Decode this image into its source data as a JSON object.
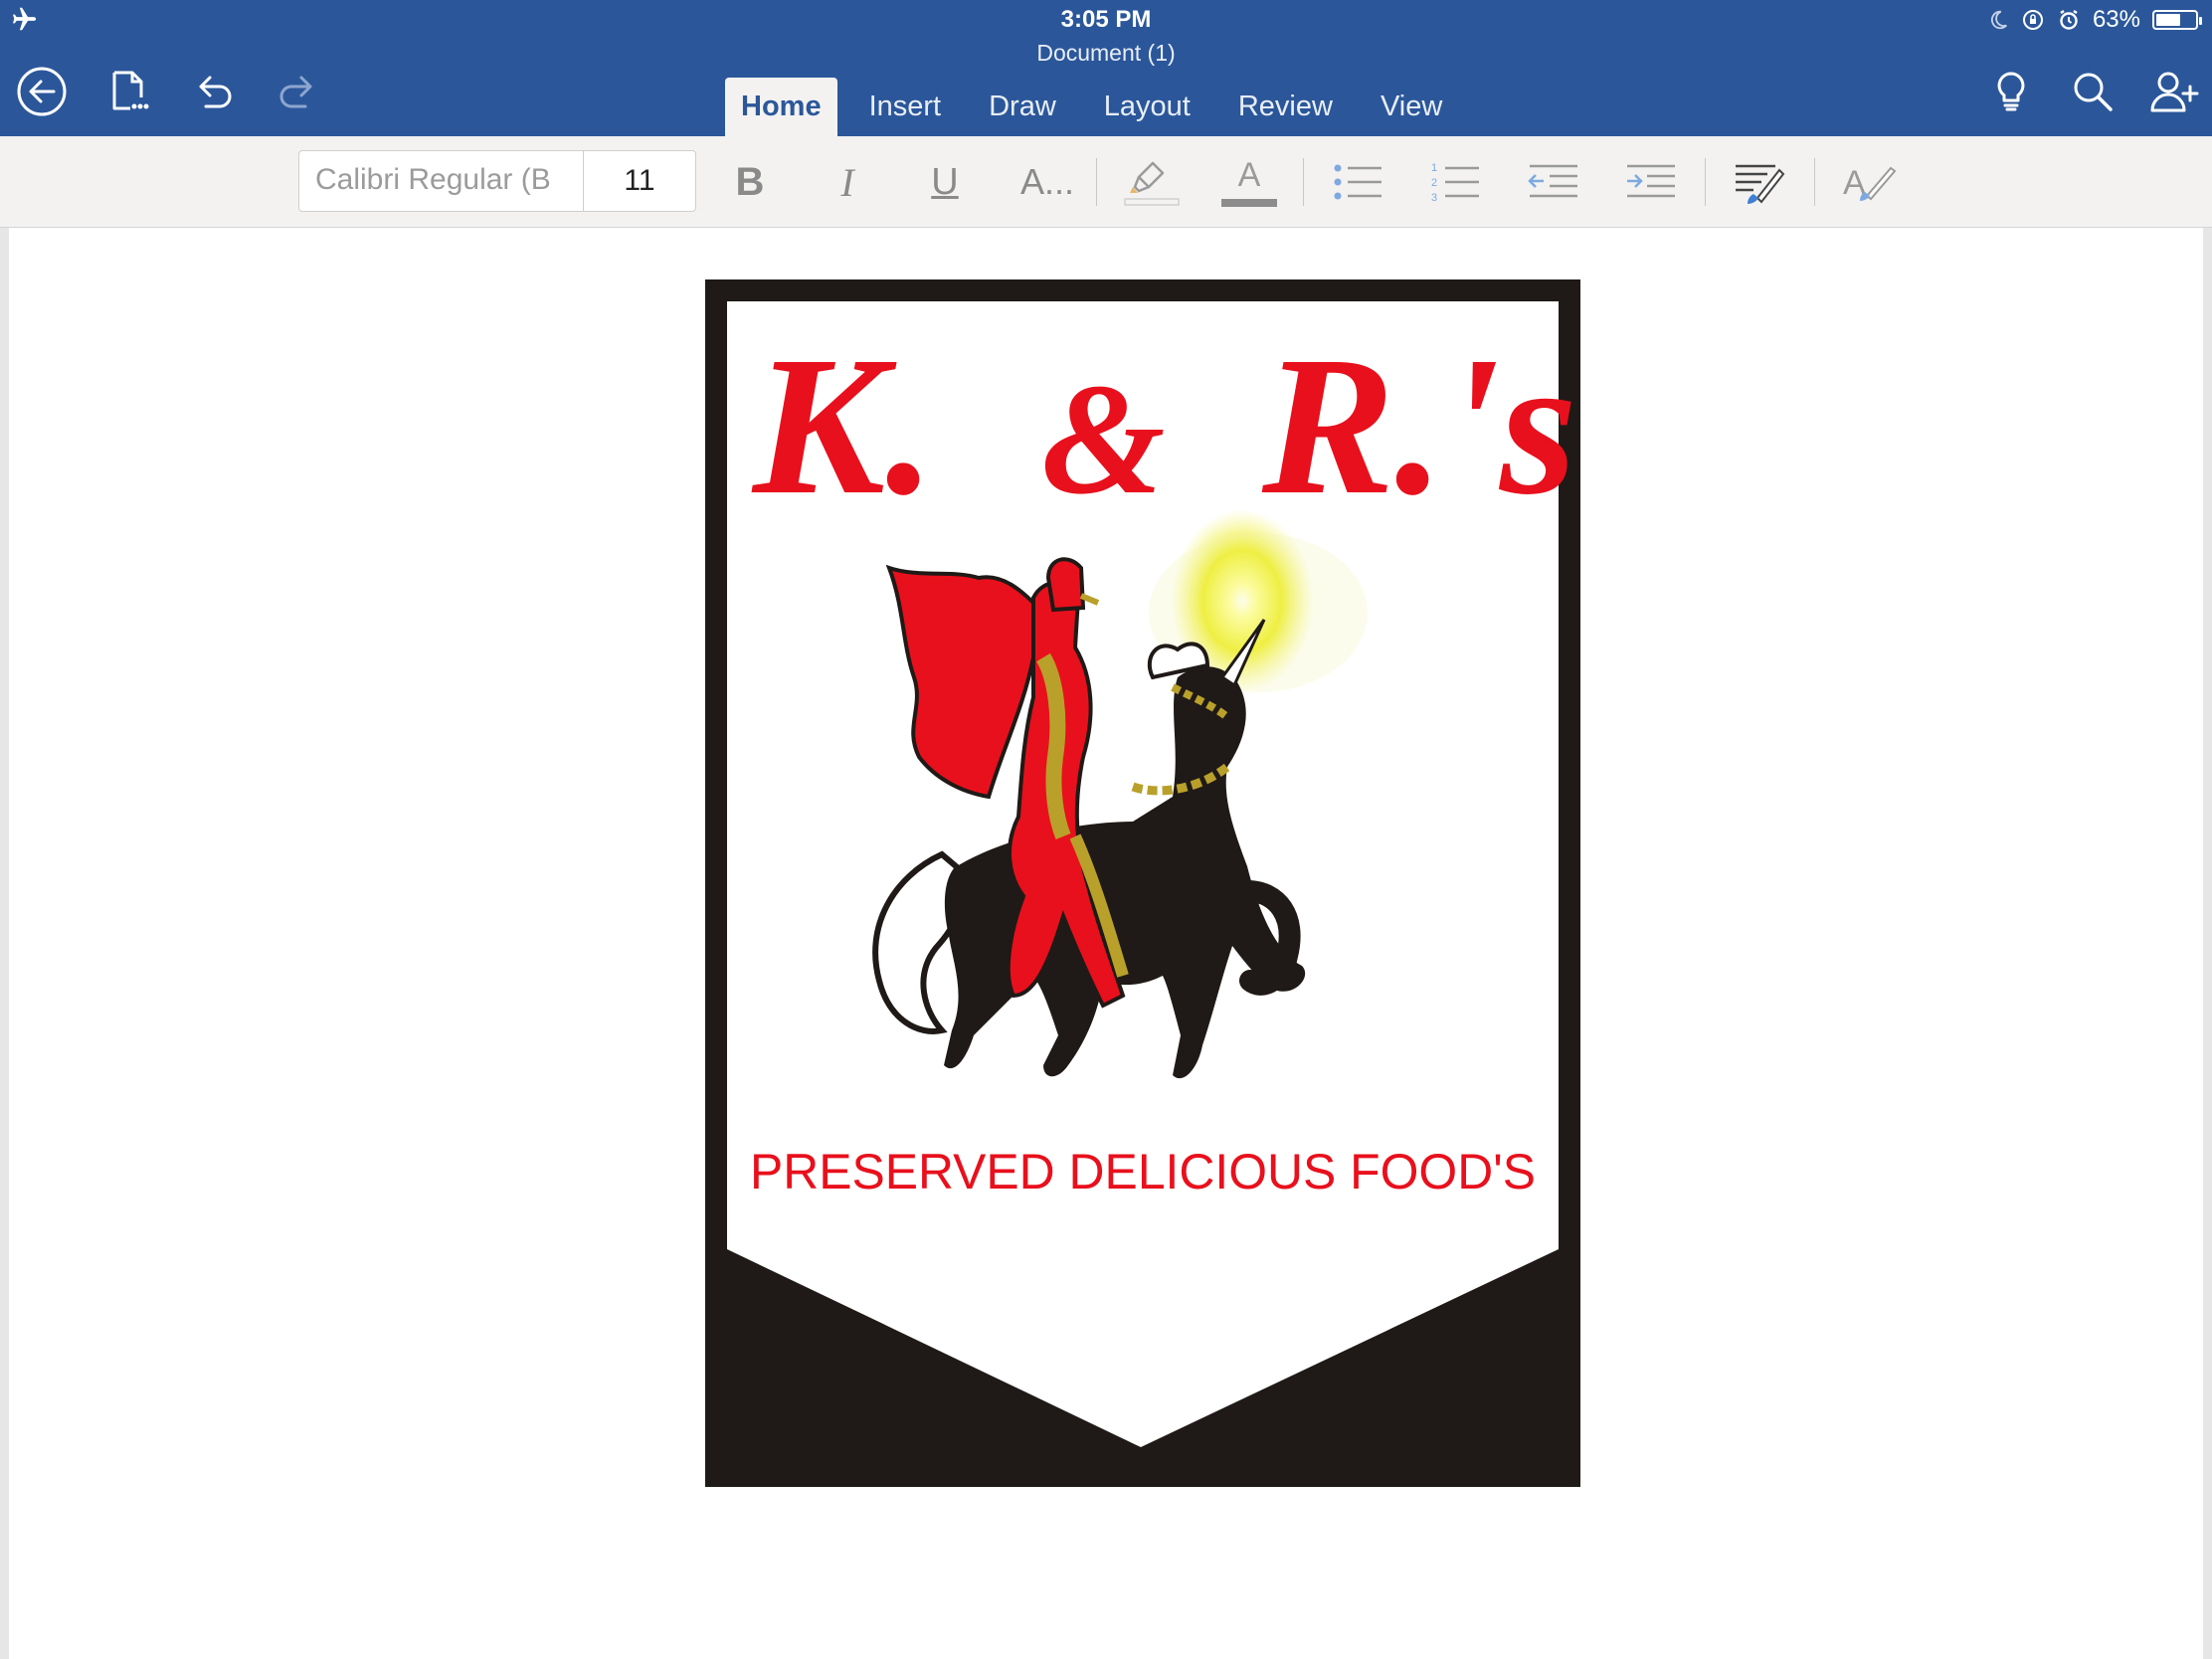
{
  "status_bar": {
    "time": "3:05 PM",
    "battery_percent": "63%",
    "battery_level": 0.63,
    "icons": [
      "airplane-icon",
      "moon-icon",
      "rotation-lock-icon",
      "alarm-icon",
      "battery-icon"
    ]
  },
  "document": {
    "title": "Document (1)"
  },
  "toolbar": {
    "left_icons": [
      "back-icon",
      "file-icon",
      "undo-icon",
      "redo-icon"
    ],
    "right_icons": [
      "lightbulb-icon",
      "search-icon",
      "share-person-icon"
    ]
  },
  "tabs": [
    {
      "label": "Home",
      "active": true
    },
    {
      "label": "Insert",
      "active": false
    },
    {
      "label": "Draw",
      "active": false
    },
    {
      "label": "Layout",
      "active": false
    },
    {
      "label": "Review",
      "active": false
    },
    {
      "label": "View",
      "active": false
    }
  ],
  "ribbon": {
    "font_name": "Calibri Regular (B",
    "font_size": "11",
    "bold_label": "B",
    "italic_label": "I",
    "underline_label": "U",
    "more_font_label": "A...",
    "font_color_label": "A",
    "styles_label": "A"
  },
  "logo": {
    "heading": "K. & R.'s",
    "heading_parts": [
      "K.",
      "&",
      "R.'s"
    ],
    "tagline": "PRESERVED DELICIOUS FOOD'S",
    "colors": {
      "red": "#e8101c",
      "black": "#1f1a17",
      "gold": "#b9a02a",
      "glow": "#f1f21f"
    }
  },
  "colors": {
    "header_blue": "#2b579a",
    "ribbon_gray": "#f3f2f1",
    "page_white": "#ffffff"
  }
}
